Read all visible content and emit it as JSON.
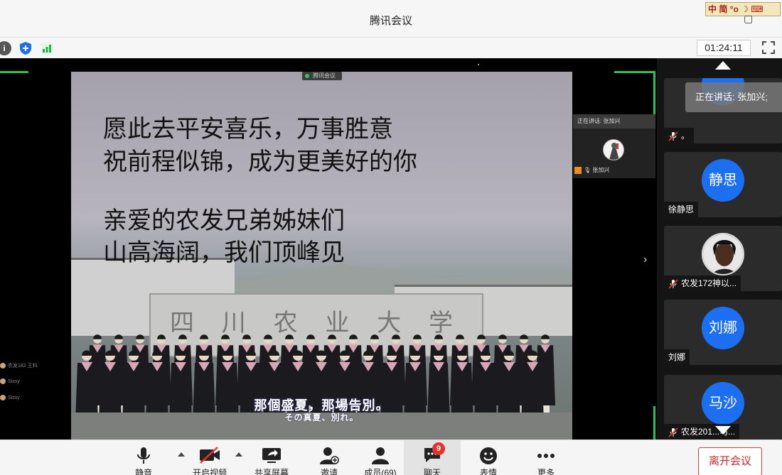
{
  "window": {
    "title": "腾讯会议",
    "ime_text": "中 简 °o ☽ ⌨"
  },
  "toolbar": {
    "timer": "01:24:11"
  },
  "video": {
    "tag": "腾讯会议",
    "lyrics": [
      "愿此去平安喜乐，万事胜意",
      "祝前程似锦，成为更美好的你",
      "亲爱的农发兄弟姊妹们",
      "山高海阔，我们顶峰见"
    ],
    "gate_text": "四 川 农 业 大 学",
    "subtitle_main": "那個盛夏，那場告別。",
    "subtitle_sub": "その真夏、別れ。"
  },
  "mini_chat": [
    "农发182 王科",
    "Sissy",
    "Sissy"
  ],
  "thumbnail": {
    "header": "正在讲话: 张加兴",
    "footer": "张加兴"
  },
  "speaking_banner": "正在讲话: 张加兴;",
  "participants": [
    {
      "name": "。",
      "avatar": "",
      "muted": true
    },
    {
      "name": "徐静思",
      "avatar": "静思",
      "muted": false
    },
    {
      "name": "农发172神以...",
      "avatar": "",
      "muted": true
    },
    {
      "name": "刘娜",
      "avatar": "刘娜",
      "muted": false
    },
    {
      "name": "农发201...马...",
      "avatar": "马沙",
      "muted": true
    }
  ],
  "bottombar": {
    "mute": "静音",
    "video": "开启视频",
    "share": "共享屏幕",
    "invite": "邀请",
    "members": "成员(69)",
    "chat": "聊天",
    "chat_badge": "9",
    "emoji": "表情",
    "more": "更多",
    "leave": "离开会议"
  }
}
